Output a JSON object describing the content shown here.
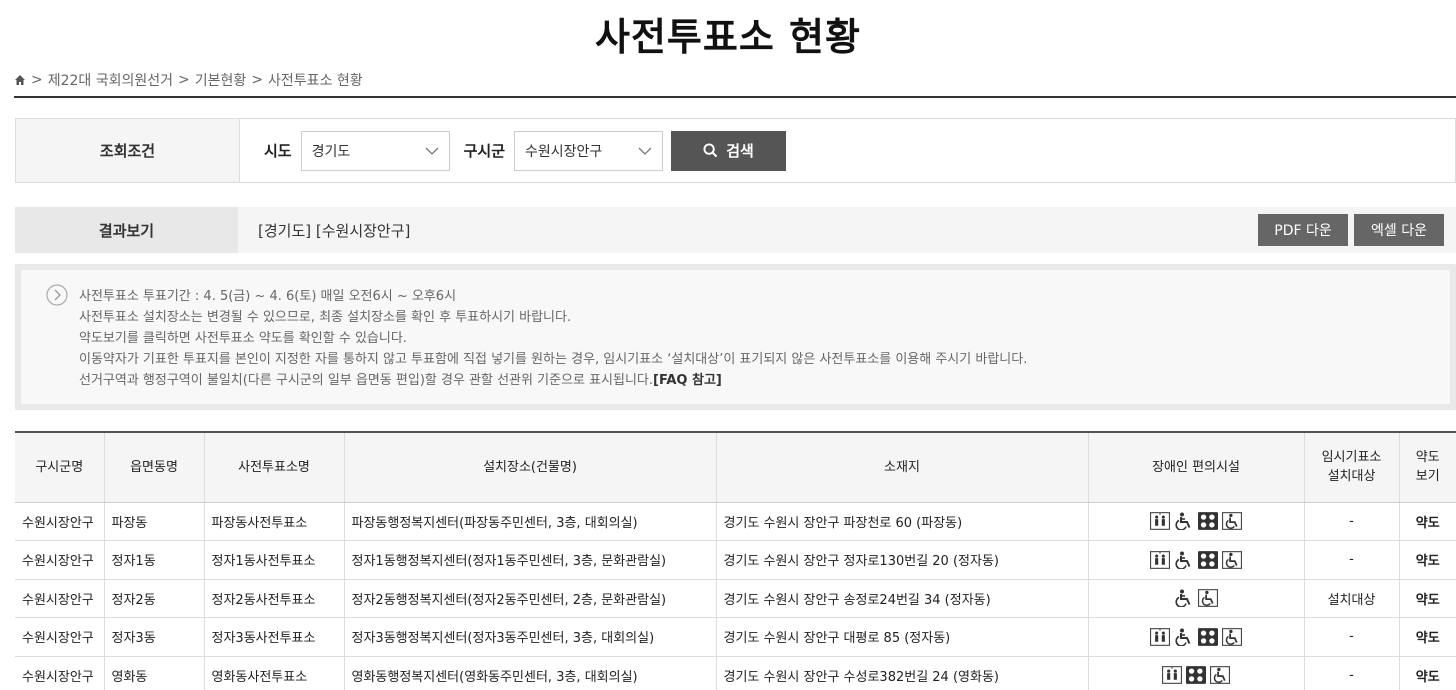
{
  "page_title": "사전투표소 현황",
  "breadcrumb": {
    "items": [
      "제22대 국회의원선거",
      "기본현황",
      "사전투표소 현황"
    ],
    "sep": ">"
  },
  "condition": {
    "label": "조회조건",
    "sido_label": "시도",
    "sido_value": "경기도",
    "gu_label": "구시군",
    "gu_value": "수원시장안구",
    "search_label": "검색"
  },
  "result": {
    "label": "결과보기",
    "text": "[경기도] [수원시장안구]",
    "pdf_label": "PDF 다운",
    "excel_label": "엑셀 다운"
  },
  "notice": {
    "lines": [
      "사전투표소 투표기간 : 4. 5(금) ~ 4. 6(토) 매일 오전6시 ~ 오후6시",
      "사전투표소 설치장소는 변경될 수 있으므로, 최종 설치장소를 확인 후 투표하시기 바랍니다.",
      "약도보기를 클릭하면 사전투표소 약도를 확인할 수 있습니다.",
      "이동약자가 기표한 투표지를 본인이 지정한 자를 통하지 않고 투표함에 직접 넣기를 원하는 경우, 임시기표소 ‘설치대상’이 표기되지 않은 사전투표소를 이용해 주시기 바랍니다.",
      "선거구역과 행정구역이 불일치(다른 구시군의 일부 읍면동 편입)할 경우 관할 선관위 기준으로 표시됩니다."
    ],
    "faq_label": "[FAQ 참고]"
  },
  "table": {
    "headers": {
      "gu": "구시군명",
      "dong": "읍면동명",
      "name": "사전투표소명",
      "place": "설치장소(건물명)",
      "address": "소재지",
      "facility": "장애인 편의시설",
      "temp_1": "임시기표소",
      "temp_2": "설치대상",
      "map_1": "약도",
      "map_2": "보기"
    },
    "rows": [
      {
        "gu": "수원시장안구",
        "dong": "파장동",
        "name": "파장동사전투표소",
        "place": "파장동행정복지센터(파장동주민센터, 3층, 대회의실)",
        "address": "경기도 수원시 장안구 파장천로 60 (파장동)",
        "facilities": [
          "elevator-icon",
          "wheelchair-icon",
          "braille-icon",
          "accessible-toilet-icon"
        ],
        "temp": "-",
        "map": "약도"
      },
      {
        "gu": "수원시장안구",
        "dong": "정자1동",
        "name": "정자1동사전투표소",
        "place": "정자1동행정복지센터(정자1동주민센터, 3층, 문화관람실)",
        "address": "경기도 수원시 장안구 정자로130번길 20 (정자동)",
        "facilities": [
          "elevator-icon",
          "wheelchair-icon",
          "braille-icon",
          "accessible-toilet-icon"
        ],
        "temp": "-",
        "map": "약도"
      },
      {
        "gu": "수원시장안구",
        "dong": "정자2동",
        "name": "정자2동사전투표소",
        "place": "정자2동행정복지센터(정자2동주민센터, 2층, 문화관람실)",
        "address": "경기도 수원시 장안구 송정로24번길 34 (정자동)",
        "facilities": [
          "wheelchair-icon",
          "accessible-toilet-icon"
        ],
        "temp": "설치대상",
        "map": "약도"
      },
      {
        "gu": "수원시장안구",
        "dong": "정자3동",
        "name": "정자3동사전투표소",
        "place": "정자3동행정복지센터(정자3동주민센터, 3층, 대회의실)",
        "address": "경기도 수원시 장안구 대평로 85 (정자동)",
        "facilities": [
          "elevator-icon",
          "wheelchair-icon",
          "braille-icon",
          "accessible-toilet-icon"
        ],
        "temp": "-",
        "map": "약도"
      },
      {
        "gu": "수원시장안구",
        "dong": "영화동",
        "name": "영화동사전투표소",
        "place": "영화동행정복지센터(영화동주민센터, 3층, 대회의실)",
        "address": "경기도 수원시 장안구 수성로382번길 24 (영화동)",
        "facilities": [
          "elevator-icon",
          "braille-icon",
          "accessible-toilet-icon"
        ],
        "temp": "-",
        "map": "약도"
      }
    ]
  }
}
